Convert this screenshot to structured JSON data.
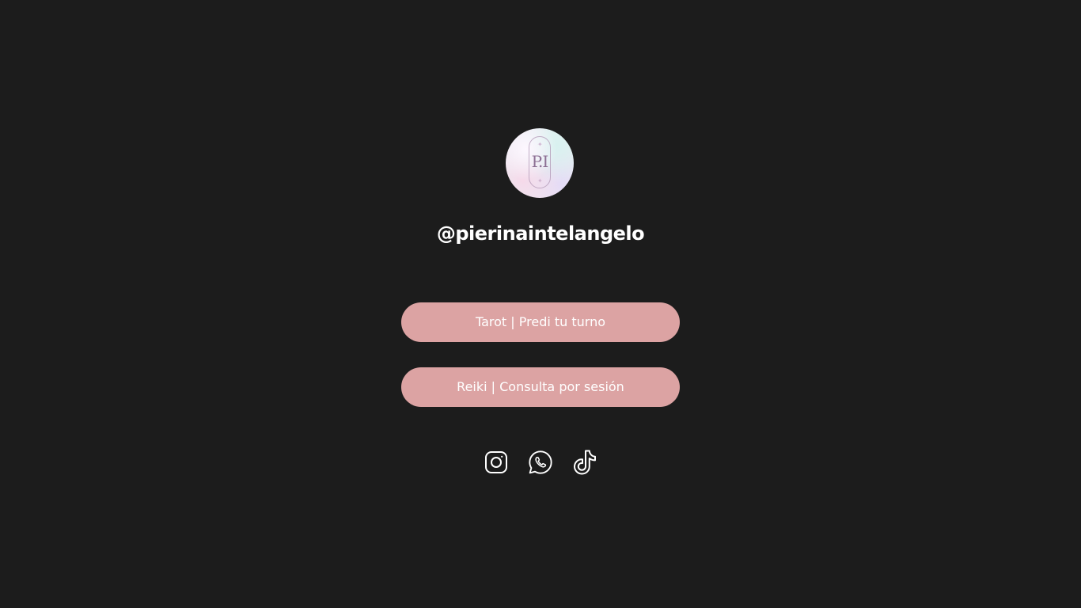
{
  "profile": {
    "monogram": "P.I",
    "handle": "@pierinaintelangelo"
  },
  "links": [
    {
      "label": "Tarot | Predi tu turno"
    },
    {
      "label": "Reiki | Consulta por sesión"
    }
  ],
  "socials": [
    {
      "icon": "instagram-icon"
    },
    {
      "icon": "whatsapp-icon"
    },
    {
      "icon": "tiktok-icon"
    }
  ],
  "colors": {
    "background": "#1c1c1c",
    "button": "#dca3a3",
    "text": "#ffffff"
  }
}
